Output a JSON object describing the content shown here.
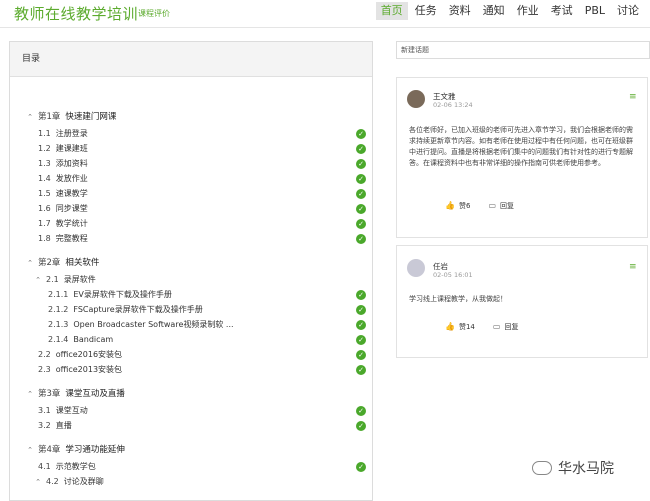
{
  "header": {
    "brand": "教师在线教学培训",
    "subtitle": "课程评价",
    "nav": [
      {
        "label": "首页",
        "active": true
      },
      {
        "label": "任务",
        "active": false
      },
      {
        "label": "资料",
        "active": false
      },
      {
        "label": "通知",
        "active": false
      },
      {
        "label": "作业",
        "active": false
      },
      {
        "label": "考试",
        "active": false
      },
      {
        "label": "PBL",
        "active": false
      },
      {
        "label": "讨论",
        "active": false
      }
    ]
  },
  "toc": {
    "title": "目录",
    "chapters": [
      {
        "num": "第1章",
        "title": "快速建门网课",
        "items": [
          {
            "num": "1.1",
            "title": "注册登录"
          },
          {
            "num": "1.2",
            "title": "建课建班"
          },
          {
            "num": "1.3",
            "title": "添加资料"
          },
          {
            "num": "1.4",
            "title": "发放作业"
          },
          {
            "num": "1.5",
            "title": "速课教学"
          },
          {
            "num": "1.6",
            "title": "同步课堂"
          },
          {
            "num": "1.7",
            "title": "教学统计"
          },
          {
            "num": "1.8",
            "title": "完整教程"
          }
        ]
      },
      {
        "num": "第2章",
        "title": "相关软件",
        "items": [
          {
            "num": "2.1",
            "title": "录屏软件",
            "sub": [
              {
                "num": "2.1.1",
                "title": "EV录屏软件下载及操作手册"
              },
              {
                "num": "2.1.2",
                "title": "FSCapture录屏软件下载及操作手册"
              },
              {
                "num": "2.1.3",
                "title": "Open Broadcaster Software视频录制软 ..."
              },
              {
                "num": "2.1.4",
                "title": "Bandicam"
              }
            ]
          },
          {
            "num": "2.2",
            "title": "office2016安装包"
          },
          {
            "num": "2.3",
            "title": "office2013安装包"
          }
        ]
      },
      {
        "num": "第3章",
        "title": "课堂互动及直播",
        "items": [
          {
            "num": "3.1",
            "title": "课堂互动"
          },
          {
            "num": "3.2",
            "title": "直播"
          }
        ]
      },
      {
        "num": "第4章",
        "title": "学习通功能延伸",
        "items": [
          {
            "num": "4.1",
            "title": "示范教学包"
          },
          {
            "num": "4.2",
            "title": "讨论及群聊",
            "sub": []
          }
        ]
      }
    ]
  },
  "side": {
    "new_topic": "新建话题",
    "posts": [
      {
        "name": "王文雅",
        "time": "02-06 13:24",
        "body": "各位老师好，已加入班级的老师可先进入章节学习，我们会根据老师的需求持续更新章节内容。如有老师在使用过程中有任何问题，也可在班级群中进行提问。直播是将根据老师们集中的问题我们有针对性的进行专题解答。在课程资料中也有非常详细的操作指南可供老师使用参考。",
        "likes": "赞6",
        "reply": "回复",
        "avatar_color": "#7a6a5a"
      },
      {
        "name": "任岩",
        "time": "02-05 16:01",
        "body": "学习线上课程教学，从我做起！",
        "likes": "赞14",
        "reply": "回复",
        "avatar_color": "#c9c9d6"
      }
    ]
  },
  "watermark": "华水马院",
  "colors": {
    "accent": "#5cab2e",
    "check": "#4aa82b"
  }
}
